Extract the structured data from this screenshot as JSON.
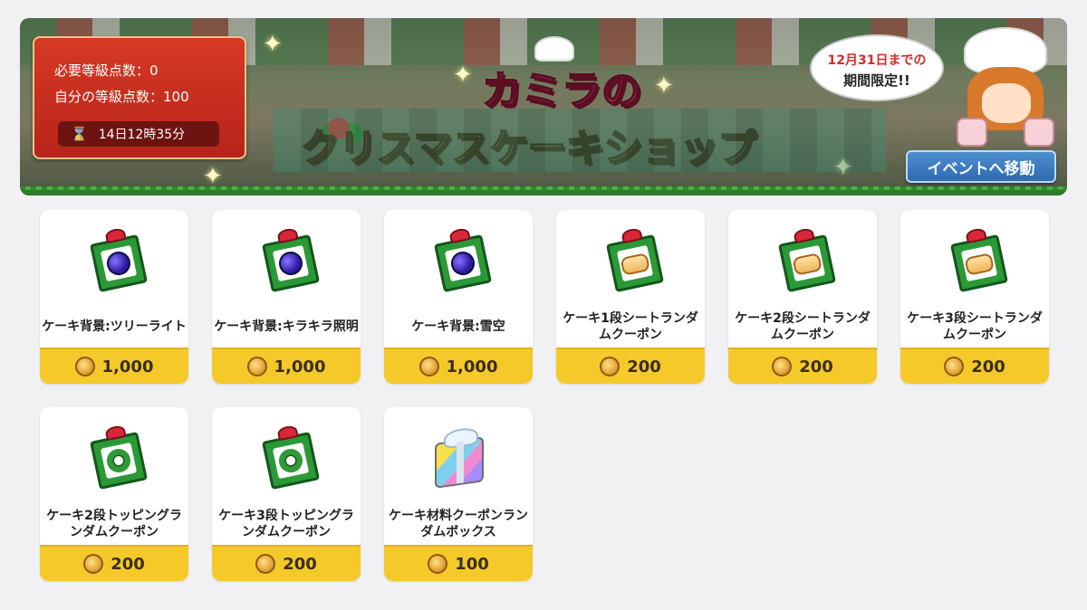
{
  "banner": {
    "required_points_label": "必要等級点数：0",
    "my_points_label": "自分の等級点数：100",
    "timer": "14日12時35分",
    "title_line1": "カミラの",
    "title_line2": "クリスマスケーキショップ",
    "limited_line1": "12月31日までの",
    "limited_line2": "期間限定!!",
    "event_button": "イベントへ移動"
  },
  "items": [
    {
      "name": "ケーキ背景:ツリーライト",
      "price": "1,000",
      "icon": "coupon-orb-icon"
    },
    {
      "name": "ケーキ背景:キラキラ照明",
      "price": "1,000",
      "icon": "coupon-orb-icon"
    },
    {
      "name": "ケーキ背景:雪空",
      "price": "1,000",
      "icon": "coupon-orb-icon"
    },
    {
      "name": "ケーキ1段シートランダムクーポン",
      "price": "200",
      "icon": "coupon-cake-icon"
    },
    {
      "name": "ケーキ2段シートランダムクーポン",
      "price": "200",
      "icon": "coupon-cake-icon"
    },
    {
      "name": "ケーキ3段シートランダムクーポン",
      "price": "200",
      "icon": "coupon-cake-icon"
    },
    {
      "name": "ケーキ2段トッピングランダムクーポン",
      "price": "200",
      "icon": "coupon-wreath-icon"
    },
    {
      "name": "ケーキ3段トッピングランダムクーポン",
      "price": "200",
      "icon": "coupon-wreath-icon"
    },
    {
      "name": "ケーキ材料クーポンランダムボックス",
      "price": "100",
      "icon": "gift-box-icon"
    }
  ]
}
